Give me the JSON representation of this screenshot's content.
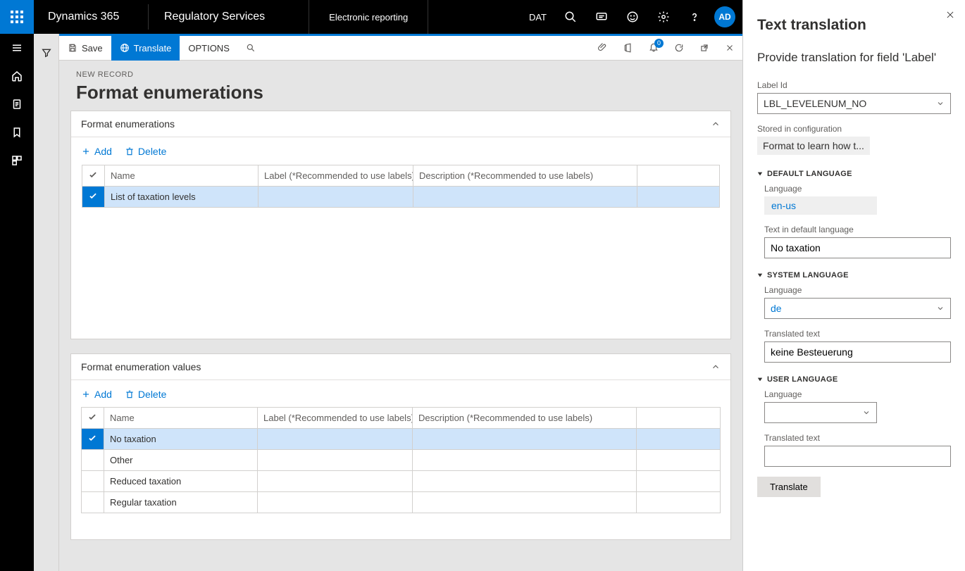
{
  "top": {
    "brand": "Dynamics 365",
    "workspace": "Regulatory Services",
    "module": "Electronic reporting",
    "company": "DAT",
    "avatar": "AD",
    "notifications_count": "0"
  },
  "actionbar": {
    "save": "Save",
    "translate": "Translate",
    "options": "OPTIONS"
  },
  "page": {
    "crumb": "NEW RECORD",
    "title": "Format enumerations"
  },
  "panel1": {
    "title": "Format enumerations",
    "add": "Add",
    "delete": "Delete",
    "cols": {
      "name": "Name",
      "label": "Label (*Recommended to use labels)",
      "desc": "Description (*Recommended to use labels)"
    },
    "rows": [
      {
        "name": "List of taxation levels",
        "label": "",
        "desc": "",
        "selected": true
      }
    ]
  },
  "panel2": {
    "title": "Format enumeration values",
    "add": "Add",
    "delete": "Delete",
    "cols": {
      "name": "Name",
      "label": "Label (*Recommended to use labels)",
      "desc": "Description (*Recommended to use labels)"
    },
    "rows": [
      {
        "name": "No taxation",
        "label": "",
        "desc": "",
        "selected": true
      },
      {
        "name": "Other",
        "label": "",
        "desc": "",
        "selected": false
      },
      {
        "name": "Reduced taxation",
        "label": "",
        "desc": "",
        "selected": false
      },
      {
        "name": "Regular taxation",
        "label": "",
        "desc": "",
        "selected": false
      }
    ]
  },
  "pane": {
    "title": "Text translation",
    "subtitle": "Provide translation for field 'Label'",
    "labelid_label": "Label Id",
    "labelid_value": "LBL_LEVELENUM_NO",
    "stored_label": "Stored in configuration",
    "stored_value": "Format to learn how t...",
    "sections": {
      "default": "DEFAULT LANGUAGE",
      "system": "SYSTEM LANGUAGE",
      "user": "USER LANGUAGE"
    },
    "default_lang_label": "Language",
    "default_lang_value": "en-us",
    "default_text_label": "Text in default language",
    "default_text_value": "No taxation",
    "system_lang_label": "Language",
    "system_lang_value": "de",
    "system_text_label": "Translated text",
    "system_text_value": "keine Besteuerung",
    "user_lang_label": "Language",
    "user_lang_value": "",
    "user_text_label": "Translated text",
    "user_text_value": "",
    "translate_btn": "Translate"
  }
}
